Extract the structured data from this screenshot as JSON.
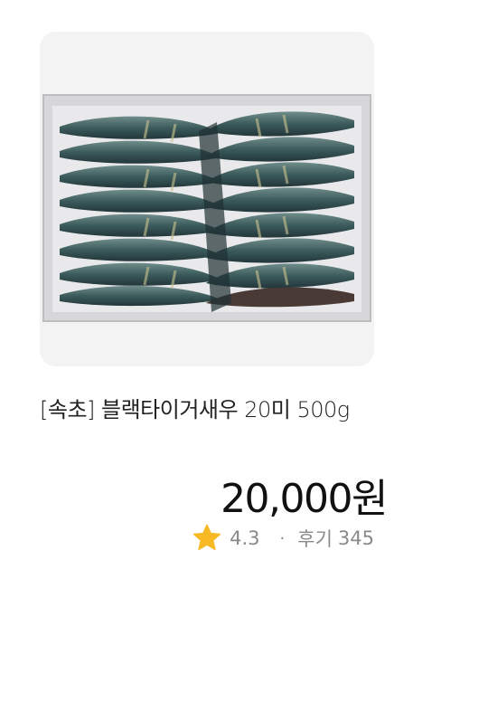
{
  "product": {
    "image_alt": "블랙타이거새우 상자",
    "title": "[속초] 블랙타이거새우 20미 500g",
    "price": "20,000원",
    "rating": "4.3",
    "separator": "·",
    "review_label": "후기",
    "review_count": "345"
  },
  "colors": {
    "star": "#F7B924",
    "price": "#111111",
    "meta_text": "#8A8A8A",
    "image_bg": "#F2F2F2"
  },
  "icons": {
    "rating": "star-icon"
  }
}
